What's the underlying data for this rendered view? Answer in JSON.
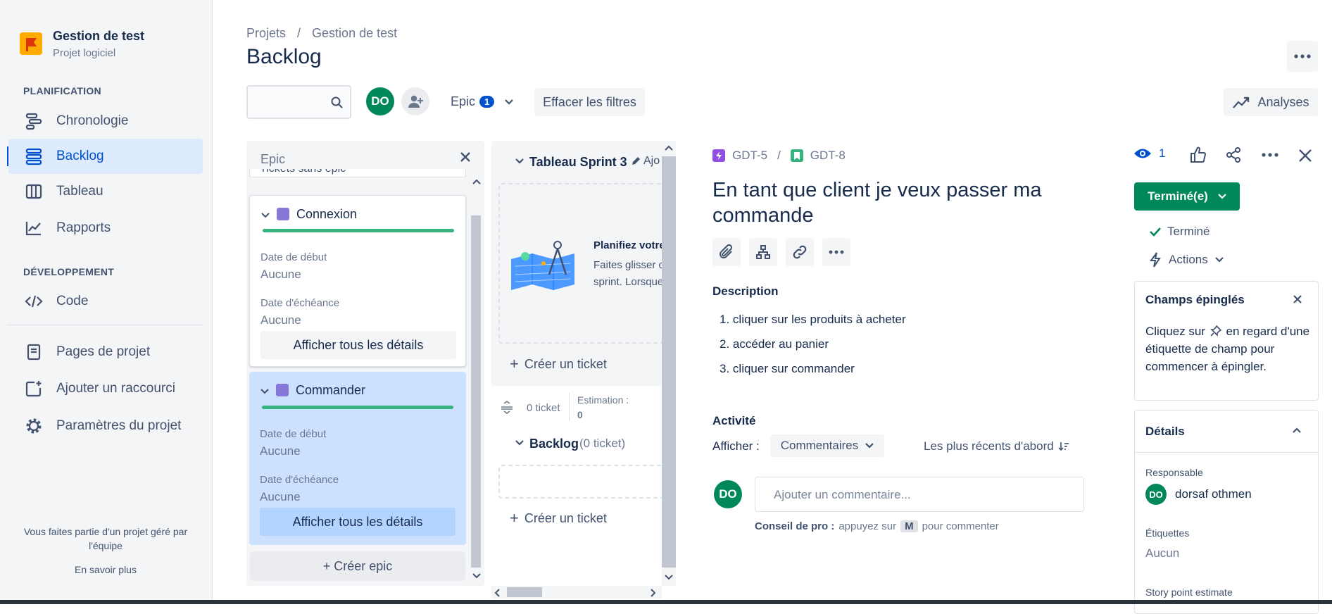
{
  "project": {
    "name": "Gestion de test",
    "type": "Projet logiciel"
  },
  "sidebar": {
    "planning_title": "PLANIFICATION",
    "planning_items": [
      {
        "label": "Chronologie",
        "icon": "timeline-icon"
      },
      {
        "label": "Backlog",
        "icon": "backlog-icon",
        "active": true
      },
      {
        "label": "Tableau",
        "icon": "board-icon"
      },
      {
        "label": "Rapports",
        "icon": "reports-icon"
      }
    ],
    "dev_title": "DÉVELOPPEMENT",
    "dev_items": [
      {
        "label": "Code",
        "icon": "code-icon"
      }
    ],
    "extra_items": [
      {
        "label": "Pages de projet",
        "icon": "pages-icon"
      },
      {
        "label": "Ajouter un raccourci",
        "icon": "add-shortcut-icon"
      },
      {
        "label": "Paramètres du projet",
        "icon": "settings-icon"
      }
    ],
    "footer_text": "Vous faites partie d'un projet géré par l'équipe",
    "footer_link": "En savoir plus"
  },
  "header": {
    "breadcrumb": [
      "Projets",
      "/",
      "Gestion de test"
    ],
    "title": "Backlog",
    "avatar_initials": "DO",
    "epic_filter_label": "Epic",
    "epic_filter_count": "1",
    "clear_filters": "Effacer les filtres",
    "analyses": "Analyses"
  },
  "epic_panel": {
    "title": "Epic",
    "no_epic": "Tickets sans epic",
    "epics": [
      {
        "name": "Connexion",
        "start_label": "Date de début",
        "start_value": "Aucune",
        "due_label": "Date d'échéance",
        "due_value": "Aucune",
        "details_button": "Afficher tous les détails"
      },
      {
        "name": "Commander",
        "start_label": "Date de début",
        "start_value": "Aucune",
        "due_label": "Date d'échéance",
        "due_value": "Aucune",
        "details_button": "Afficher tous les détails"
      }
    ],
    "create_epic": "+ Créer epic"
  },
  "backlog_panel": {
    "sprint_title": "Tableau Sprint 3",
    "sprint_add": "Ajo",
    "empty_title": "Planifiez votre",
    "empty_text_1": "Faites glisser c",
    "empty_text_2": "sprint. Lorsque",
    "create_ticket": "Créer un ticket",
    "ticket_count": "0 ticket",
    "estimation_label": "Estimation :",
    "estimation_value": "0",
    "backlog_title": "Backlog",
    "backlog_count": "(0 ticket)",
    "create_ticket_2": "Créer un ticket"
  },
  "issue": {
    "parent_key": "GDT-5",
    "separator": "/",
    "key": "GDT-8",
    "watchers": "1",
    "title": "En tant que client je veux passer ma commande",
    "description_label": "Description",
    "description_items": [
      "cliquer sur les produits à acheter",
      "accéder au panier",
      "cliquer sur commander"
    ],
    "description_numbers": [
      "1.",
      "2.",
      "3."
    ],
    "activity_label": "Activité",
    "show_label": "Afficher :",
    "show_value": "Commentaires",
    "sort_label": "Les plus récents d'abord",
    "comment_placeholder": "Ajouter un commentaire...",
    "avatar_initials": "DO",
    "tip_bold": "Conseil de pro :",
    "tip_text": "appuyez sur",
    "tip_key": "M",
    "tip_end": "pour commenter"
  },
  "issue_side": {
    "status_button": "Terminé(e)",
    "status_done": "Terminé",
    "actions": "Actions",
    "pinned_title": "Champs épinglés",
    "pinned_text_1": "Cliquez sur",
    "pinned_text_2": "en regard d'une étiquette de champ pour commencer à épingler.",
    "details_title": "Détails",
    "assignee_label": "Responsable",
    "assignee_initials": "DO",
    "assignee_name": "dorsaf othmen",
    "labels_label": "Étiquettes",
    "labels_value": "Aucun",
    "story_points_label": "Story point estimate"
  },
  "colors": {
    "primary": "#0052CC",
    "green": "#00875A",
    "progress": "#36B37E",
    "epic": "#8777D9",
    "selected_bg": "#CCE0FF"
  }
}
